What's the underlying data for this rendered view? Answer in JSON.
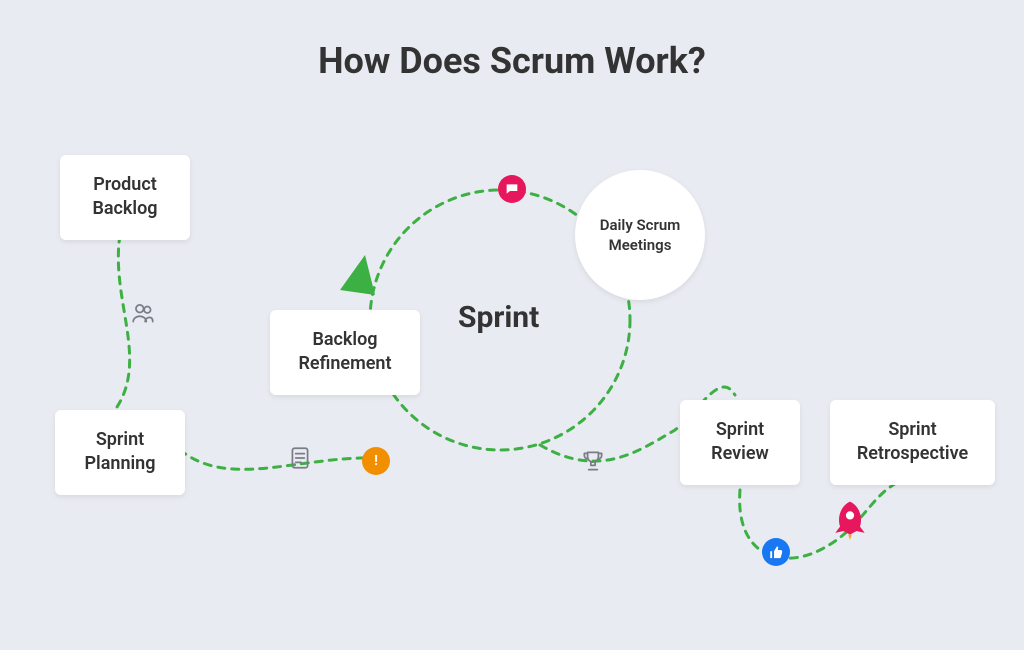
{
  "title": "How Does Scrum Work?",
  "nodes": {
    "product_backlog": "Product\nBacklog",
    "sprint_planning": "Sprint\nPlanning",
    "backlog_refinement": "Backlog\nRefinement",
    "sprint": "Sprint",
    "daily_scrum": "Daily Scrum\nMeetings",
    "sprint_review": "Sprint\nReview",
    "sprint_retrospective": "Sprint\nRetrospective"
  },
  "icons": {
    "team": "team-icon",
    "checklist": "checklist-icon",
    "alert": "alert-icon",
    "chat": "chat-icon",
    "trophy": "trophy-icon",
    "thumbs": "thumbs-up-icon",
    "rocket": "rocket-icon"
  },
  "colors": {
    "path": "#3cb043",
    "magenta": "#e6175c",
    "orange": "#f18f01",
    "blue": "#1877f2",
    "bg": "#e9ebf2"
  }
}
